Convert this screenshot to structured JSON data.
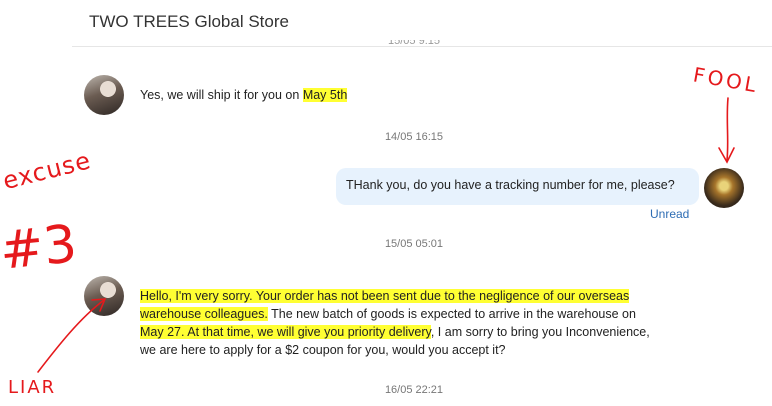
{
  "header": {
    "store_name": "TWO TREES Global Store"
  },
  "timestamps": {
    "t0": "15/05 9:15",
    "t1": "14/05 16:15",
    "t2": "15/05 05:01",
    "t3": "16/05 22:21"
  },
  "messages": {
    "m1": {
      "pre": "Yes, we will ship it for you on ",
      "highlight": "May 5th"
    },
    "m2": {
      "text": "THank you, do you have a tracking number for me, please?",
      "status": "Unread"
    },
    "m3": {
      "l1": "Hello, I'm very sorry. Your order has not been sent due to the negligence of our overseas",
      "l2_hl": "warehouse colleagues.",
      "l2_rest": " The new batch of goods is expected to arrive in the warehouse on",
      "l3_hl": "May 27. At that time, we will give you priority delivery",
      "l3_rest": ", I am sorry to bring you Inconvenience,",
      "l4": "we are here to apply for a $2 coupon for you, would you accept it?"
    }
  },
  "annotations": {
    "excuse": "excuse",
    "number": "#3",
    "fool": "FOOL",
    "liar": "LIAR"
  },
  "colors": {
    "highlight": "#ffff33",
    "annotation": "#e5191c",
    "bubble": "#e7f2fd",
    "link": "#2e6db4"
  }
}
